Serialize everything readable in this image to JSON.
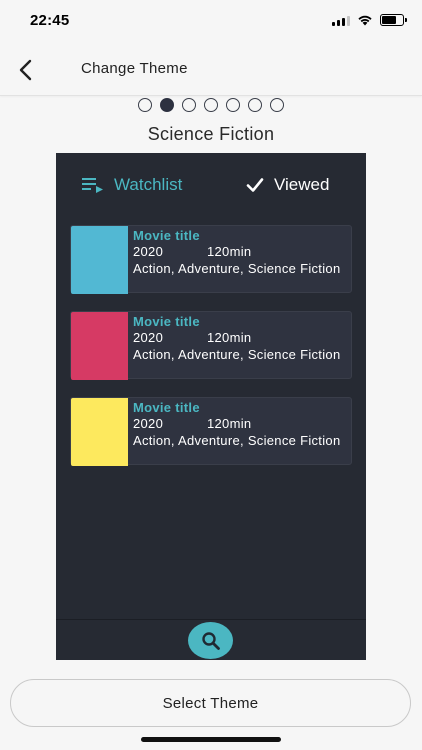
{
  "status_bar": {
    "time": "22:45"
  },
  "nav": {
    "title": "Change Theme",
    "back_icon": "chevron-left-icon"
  },
  "theme_pager": {
    "count": 7,
    "active_index": 1
  },
  "theme_name": "Science Fiction",
  "preview": {
    "background": "#262a33",
    "accent": "#4bb7c2",
    "tabs": {
      "watchlist_label": "Watchlist",
      "watchlist_icon": "playlist-icon",
      "viewed_label": "Viewed",
      "viewed_icon": "checkmark-icon"
    },
    "movies": [
      {
        "title": "Movie title",
        "year": "2020",
        "duration": "120min",
        "genres": "Action, Adventure, Science Fiction",
        "poster_color": "#52b8d3"
      },
      {
        "title": "Movie title",
        "year": "2020",
        "duration": "120min",
        "genres": "Action, Adventure, Science Fiction",
        "poster_color": "#d63a64"
      },
      {
        "title": "Movie title",
        "year": "2020",
        "duration": "120min",
        "genres": "Action, Adventure, Science Fiction",
        "poster_color": "#fde95e"
      }
    ],
    "fab_icon": "search-icon"
  },
  "select_button_label": "Select Theme"
}
